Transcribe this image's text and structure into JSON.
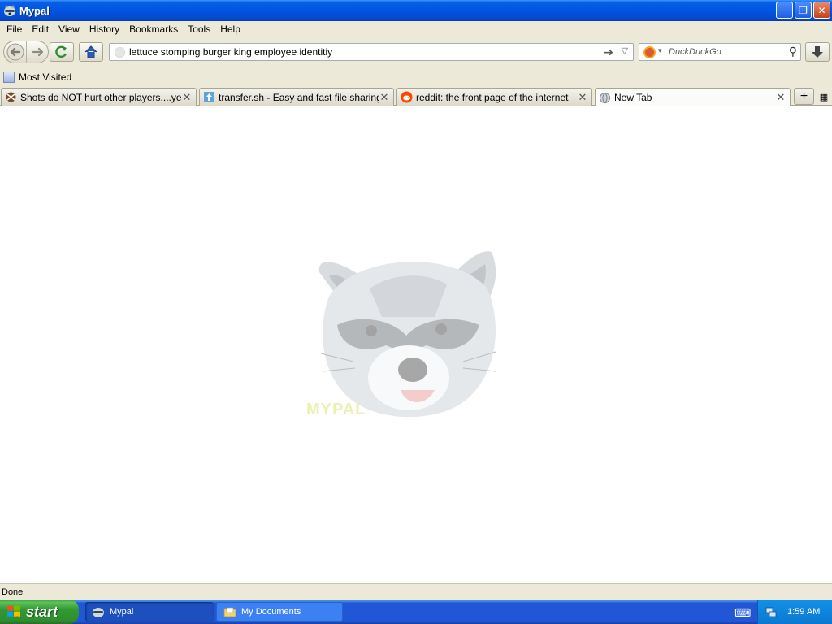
{
  "window": {
    "title": "Mypal",
    "controls": {
      "minimize": "_",
      "restore": "❐",
      "close": "✕"
    }
  },
  "menubar": {
    "items": [
      {
        "label": "File"
      },
      {
        "label": "Edit"
      },
      {
        "label": "View"
      },
      {
        "label": "History"
      },
      {
        "label": "Bookmarks"
      },
      {
        "label": "Tools"
      },
      {
        "label": "Help"
      }
    ]
  },
  "navbar": {
    "url_value": "lettuce stomping burger king employee identitiy",
    "search_placeholder": "DuckDuckGo",
    "icons": {
      "back": "back-arrow-icon",
      "forward": "forward-arrow-icon",
      "reload": "reload-icon",
      "home": "home-icon",
      "go": "go-arrow-icon",
      "search": "magnifier-icon",
      "download": "download-arrow-icon"
    }
  },
  "bookmarks": {
    "items": [
      {
        "label": "Most Visited"
      }
    ]
  },
  "tabs": [
    {
      "label": "Shots do NOT hurt other players....yet.",
      "active": false
    },
    {
      "label": "transfer.sh - Easy and fast file sharing ...",
      "active": false
    },
    {
      "label": "reddit: the front page of the internet",
      "active": false
    },
    {
      "label": "New Tab",
      "active": true
    }
  ],
  "content": {
    "logo_text": "MYPAL"
  },
  "status": {
    "text": "Done"
  },
  "taskbar": {
    "start_label": "start",
    "windows": [
      {
        "label": "Mypal",
        "active": true
      },
      {
        "label": "My Documents",
        "active": false
      }
    ],
    "clock": "1:59 AM"
  },
  "colors": {
    "titlebar": "#0054e3",
    "chrome": "#ece9d8",
    "start_green": "#339933",
    "taskbar_blue": "#2157d7",
    "tray_blue": "#0c79d1"
  }
}
